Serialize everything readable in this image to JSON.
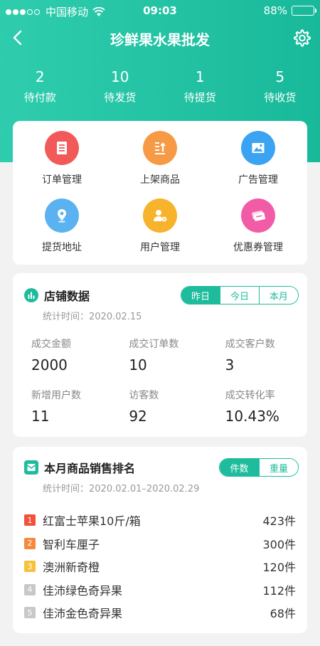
{
  "status_bar": {
    "carrier": "中国移动",
    "time": "09:03",
    "battery": "88%"
  },
  "nav": {
    "title": "珍鲜果水果批发"
  },
  "orders": [
    {
      "count": "2",
      "label": "待付款"
    },
    {
      "count": "10",
      "label": "待发货"
    },
    {
      "count": "1",
      "label": "待提货"
    },
    {
      "count": "5",
      "label": "待收货"
    }
  ],
  "menu": [
    {
      "label": "订单管理",
      "icon": "order-list-icon",
      "color": "#f25a5a"
    },
    {
      "label": "上架商品",
      "icon": "upload-goods-icon",
      "color": "#f79a45"
    },
    {
      "label": "广告管理",
      "icon": "image-ad-icon",
      "color": "#3aa3f2"
    },
    {
      "label": "提货地址",
      "icon": "location-pin-icon",
      "color": "#5ab3f0"
    },
    {
      "label": "用户管理",
      "icon": "user-settings-icon",
      "color": "#f6b32b"
    },
    {
      "label": "优惠券管理",
      "icon": "coupon-icon",
      "color": "#f25ca6"
    }
  ],
  "store_data": {
    "title": "店铺数据",
    "tabs": [
      "昨日",
      "今日",
      "本月"
    ],
    "active_tab": "昨日",
    "stat_time": "统计时间：2020.02.15",
    "metrics": [
      {
        "label": "成交金额",
        "value": "2000"
      },
      {
        "label": "成交订单数",
        "value": "10"
      },
      {
        "label": "成交客户数",
        "value": "3"
      },
      {
        "label": "新增用户数",
        "value": "11"
      },
      {
        "label": "访客数",
        "value": "92"
      },
      {
        "label": "成交转化率",
        "value": "10.43%"
      }
    ]
  },
  "ranking": {
    "title": "本月商品销售排名",
    "tabs": [
      "件数",
      "重量"
    ],
    "active_tab": "件数",
    "stat_time": "统计时间：2020.02.01–2020.02.29",
    "items": [
      {
        "rank": "1",
        "name": "红富士苹果10斤/箱",
        "count": "423件",
        "color": "#f0523a"
      },
      {
        "rank": "2",
        "name": "智利车厘子",
        "count": "300件",
        "color": "#f58a3c"
      },
      {
        "rank": "3",
        "name": "澳洲新奇橙",
        "count": "120件",
        "color": "#f7c23a"
      },
      {
        "rank": "4",
        "name": "佳沛绿色奇异果",
        "count": "112件",
        "color": "#c8c8c8"
      },
      {
        "rank": "5",
        "name": "佳沛金色奇异果",
        "count": "68件",
        "color": "#c8c8c8"
      }
    ]
  },
  "colors": {
    "brand": "#1ebc9c"
  }
}
